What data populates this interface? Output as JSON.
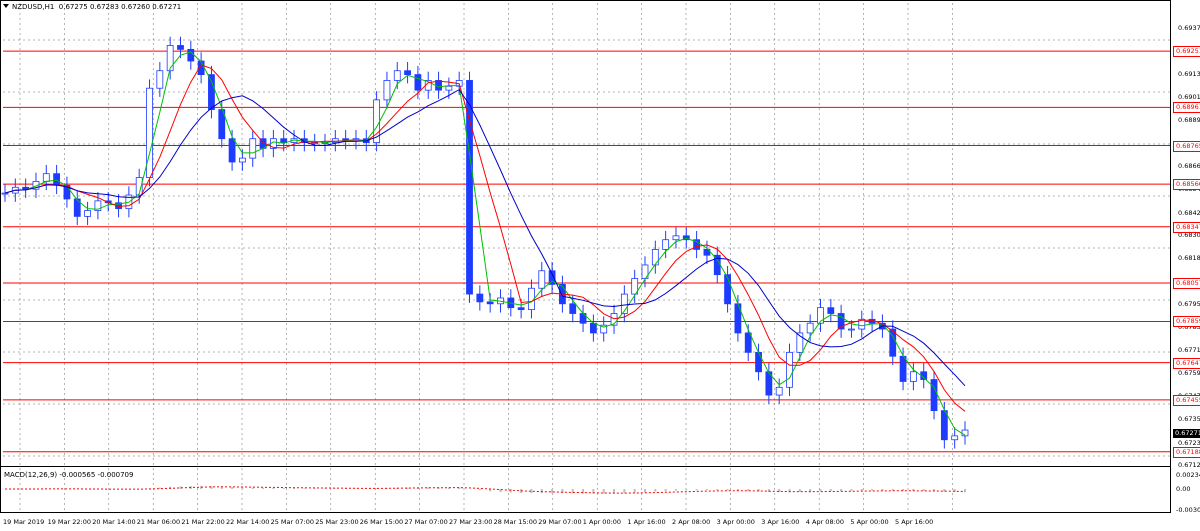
{
  "window": {
    "title": "NZDUSD,H1",
    "ohlc": "0.67275 0.67283 0.67260 0.67271"
  },
  "macd": {
    "label": "MACD(12,26,9) -0.000565 -0.000709",
    "scale": [
      "0.00234",
      "0.00",
      "-0.00307"
    ]
  },
  "price_axis": [
    "0.69370",
    "0.69135",
    "0.69015",
    "0.68895",
    "0.68660",
    "0.68540",
    "0.68420",
    "0.68305",
    "0.68185",
    "0.67950",
    "0.67830",
    "0.67710",
    "0.67595",
    "0.67475",
    "0.67355",
    "0.67235",
    "0.67120"
  ],
  "levels": [
    "0.69251",
    "0.68961",
    "0.68765",
    "0.68566",
    "0.68347",
    "0.68057",
    "0.67859",
    "0.67647",
    "0.67455",
    "0.67188"
  ],
  "bid": "0.67271",
  "time_axis": [
    "19 Mar 2019",
    "19 Mar 22:00",
    "20 Mar 14:00",
    "21 Mar 06:00",
    "21 Mar 22:00",
    "22 Mar 14:00",
    "25 Mar 07:00",
    "25 Mar 23:00",
    "26 Mar 15:00",
    "27 Mar 07:00",
    "27 Mar 23:00",
    "28 Mar 15:00",
    "29 Mar 07:00",
    "1 Apr 00:00",
    "1 Apr 16:00",
    "2 Apr 08:00",
    "3 Apr 00:00",
    "3 Apr 16:00",
    "4 Apr 08:00",
    "5 Apr 00:00",
    "5 Apr 16:00"
  ],
  "colors": {
    "candles": "#1e3cff",
    "level_lines": "#ff0000",
    "ma_fast": "#00c000",
    "ma_mid": "#ff0000",
    "ma_slow": "#0000cc",
    "grid": "#000000",
    "macd_hist": "#c0c0c0",
    "macd_signal": "#ff0000"
  },
  "chart_data": {
    "type": "candlestick",
    "symbol": "NZDUSD",
    "timeframe": "H1",
    "ylim": [
      0.6712,
      0.6937
    ],
    "close": [
      0.6852,
      0.6855,
      0.6854,
      0.6858,
      0.6862,
      0.6856,
      0.6849,
      0.684,
      0.6843,
      0.6848,
      0.6847,
      0.6844,
      0.6851,
      0.686,
      0.6906,
      0.6915,
      0.6928,
      0.6926,
      0.692,
      0.6913,
      0.6895,
      0.688,
      0.6868,
      0.687,
      0.688,
      0.6875,
      0.688,
      0.6878,
      0.688,
      0.6878,
      0.6878,
      0.6878,
      0.688,
      0.6879,
      0.688,
      0.6878,
      0.69,
      0.691,
      0.6915,
      0.6913,
      0.6905,
      0.691,
      0.6905,
      0.6907,
      0.691,
      0.68,
      0.6796,
      0.6795,
      0.6798,
      0.6793,
      0.6792,
      0.6803,
      0.6812,
      0.6805,
      0.6795,
      0.679,
      0.6785,
      0.678,
      0.6784,
      0.679,
      0.68,
      0.6808,
      0.6815,
      0.6823,
      0.6828,
      0.683,
      0.6828,
      0.6823,
      0.682,
      0.681,
      0.6795,
      0.678,
      0.677,
      0.676,
      0.6748,
      0.6752,
      0.677,
      0.678,
      0.6785,
      0.6793,
      0.679,
      0.6782,
      0.6782,
      0.6787,
      0.6785,
      0.6782,
      0.6768,
      0.6755,
      0.676,
      0.6756,
      0.674,
      0.6725,
      0.6727,
      0.673
    ]
  }
}
